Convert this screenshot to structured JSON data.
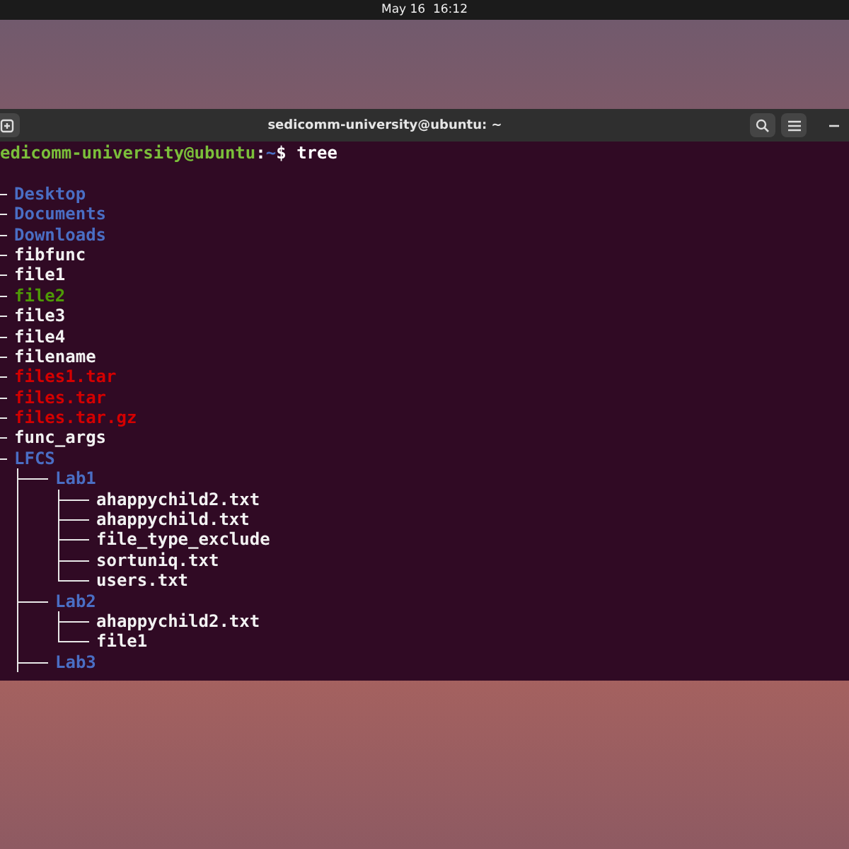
{
  "top_bar": {
    "clock": "May 16  16:12"
  },
  "window": {
    "title": "sedicomm-university@ubuntu: ~"
  },
  "prompt": {
    "user": "edicomm-university@ubuntu",
    "separator": ":",
    "path": "~",
    "symbol": "$",
    "command": "tree"
  },
  "tree": {
    "children": [
      {
        "name": "Desktop",
        "kind": "dir"
      },
      {
        "name": "Documents",
        "kind": "dir"
      },
      {
        "name": "Downloads",
        "kind": "dir"
      },
      {
        "name": "fibfunc",
        "kind": "file"
      },
      {
        "name": "file1",
        "kind": "file"
      },
      {
        "name": "file2",
        "kind": "exec"
      },
      {
        "name": "file3",
        "kind": "file"
      },
      {
        "name": "file4",
        "kind": "file"
      },
      {
        "name": "filename",
        "kind": "file"
      },
      {
        "name": "files1.tar",
        "kind": "archive"
      },
      {
        "name": "files.tar",
        "kind": "archive"
      },
      {
        "name": "files.tar.gz",
        "kind": "archive"
      },
      {
        "name": "func_args",
        "kind": "file"
      },
      {
        "name": "LFCS",
        "kind": "dir",
        "truncated": true,
        "children": [
          {
            "name": "Lab1",
            "kind": "dir",
            "children": [
              {
                "name": "ahappychild2.txt",
                "kind": "file"
              },
              {
                "name": "ahappychild.txt",
                "kind": "file"
              },
              {
                "name": "file_type_exclude",
                "kind": "file"
              },
              {
                "name": "sortuniq.txt",
                "kind": "file"
              },
              {
                "name": "users.txt",
                "kind": "file"
              }
            ]
          },
          {
            "name": "Lab2",
            "kind": "dir",
            "children": [
              {
                "name": "ahappychild2.txt",
                "kind": "file"
              },
              {
                "name": "file1",
                "kind": "file"
              }
            ]
          },
          {
            "name": "Lab3",
            "kind": "dir"
          }
        ]
      }
    ]
  }
}
